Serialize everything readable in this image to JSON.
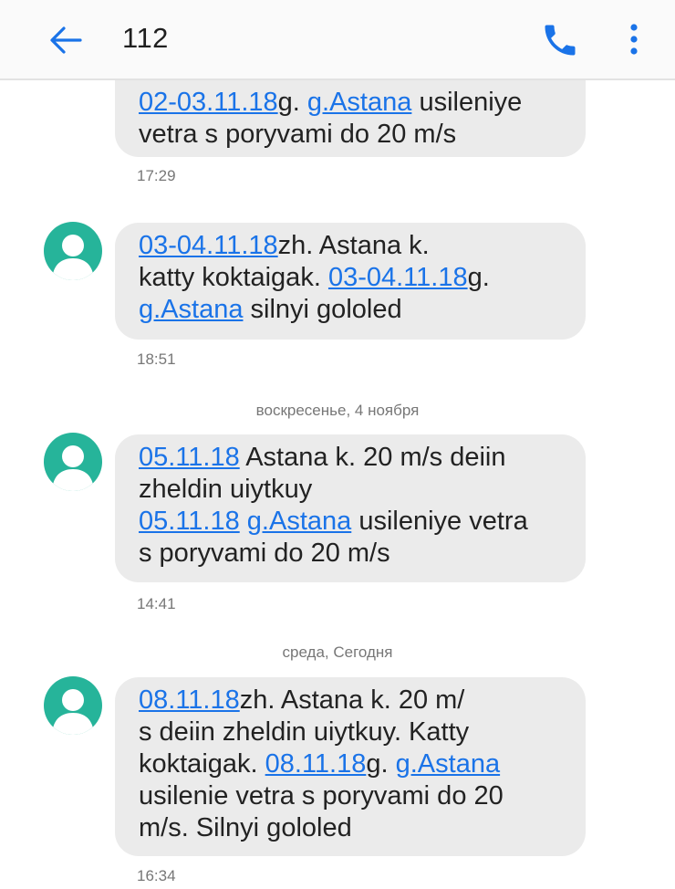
{
  "header": {
    "title": "112",
    "back_icon": "arrow-left-icon",
    "call_icon": "phone-icon",
    "more_icon": "more-vertical-icon",
    "accent": "#1a73e8"
  },
  "messages": [
    {
      "lines": [
        [
          {
            "t": "02-03.11.18",
            "link": true
          },
          {
            "t": "g. "
          },
          {
            "t": "g.Astana",
            "link": true
          },
          {
            "t": " usileniye"
          }
        ],
        [
          {
            "t": "vetra s poryvami do 20 m/s"
          }
        ]
      ],
      "time": "17:29"
    },
    {
      "lines": [
        [
          {
            "t": "03-04.11.18",
            "link": true
          },
          {
            "t": "zh. Astana k."
          }
        ],
        [
          {
            "t": "katty koktaigak. "
          },
          {
            "t": "03-04.11.18",
            "link": true
          },
          {
            "t": "g."
          }
        ],
        [
          {
            "t": "g.Astana",
            "link": true
          },
          {
            "t": " silnyi gololed"
          }
        ]
      ],
      "time": "18:51"
    },
    {
      "lines": [
        [
          {
            "t": "05.11.18",
            "link": true
          },
          {
            "t": " Astana k. 20 m/s deiin"
          }
        ],
        [
          {
            "t": "zheldin uiytkuy"
          }
        ],
        [
          {
            "t": "05.11.18",
            "link": true
          },
          {
            "t": " "
          },
          {
            "t": "g.Astana",
            "link": true
          },
          {
            "t": " usileniye vetra"
          }
        ],
        [
          {
            "t": "s poryvami do 20 m/s"
          }
        ]
      ],
      "time": "14:41"
    },
    {
      "lines": [
        [
          {
            "t": "08.11.18",
            "link": true
          },
          {
            "t": "zh. Astana k. 20 m/"
          }
        ],
        [
          {
            "t": "s deiin zheldin uiytkuy. Katty"
          }
        ],
        [
          {
            "t": "koktaigak. "
          },
          {
            "t": "08.11.18",
            "link": true
          },
          {
            "t": "g. "
          },
          {
            "t": "g.Astana",
            "link": true
          }
        ],
        [
          {
            "t": "usilenie vetra s poryvami do 20"
          }
        ],
        [
          {
            "t": "m/s. Silnyi gololed"
          }
        ]
      ],
      "time": "16:34"
    }
  ],
  "separators": [
    "воскресенье, 4 ноября",
    "среда, Сегодня"
  ],
  "bubble_color": "#ebebeb",
  "avatar_color": "#26b49a",
  "avatar_icon": "person-icon"
}
